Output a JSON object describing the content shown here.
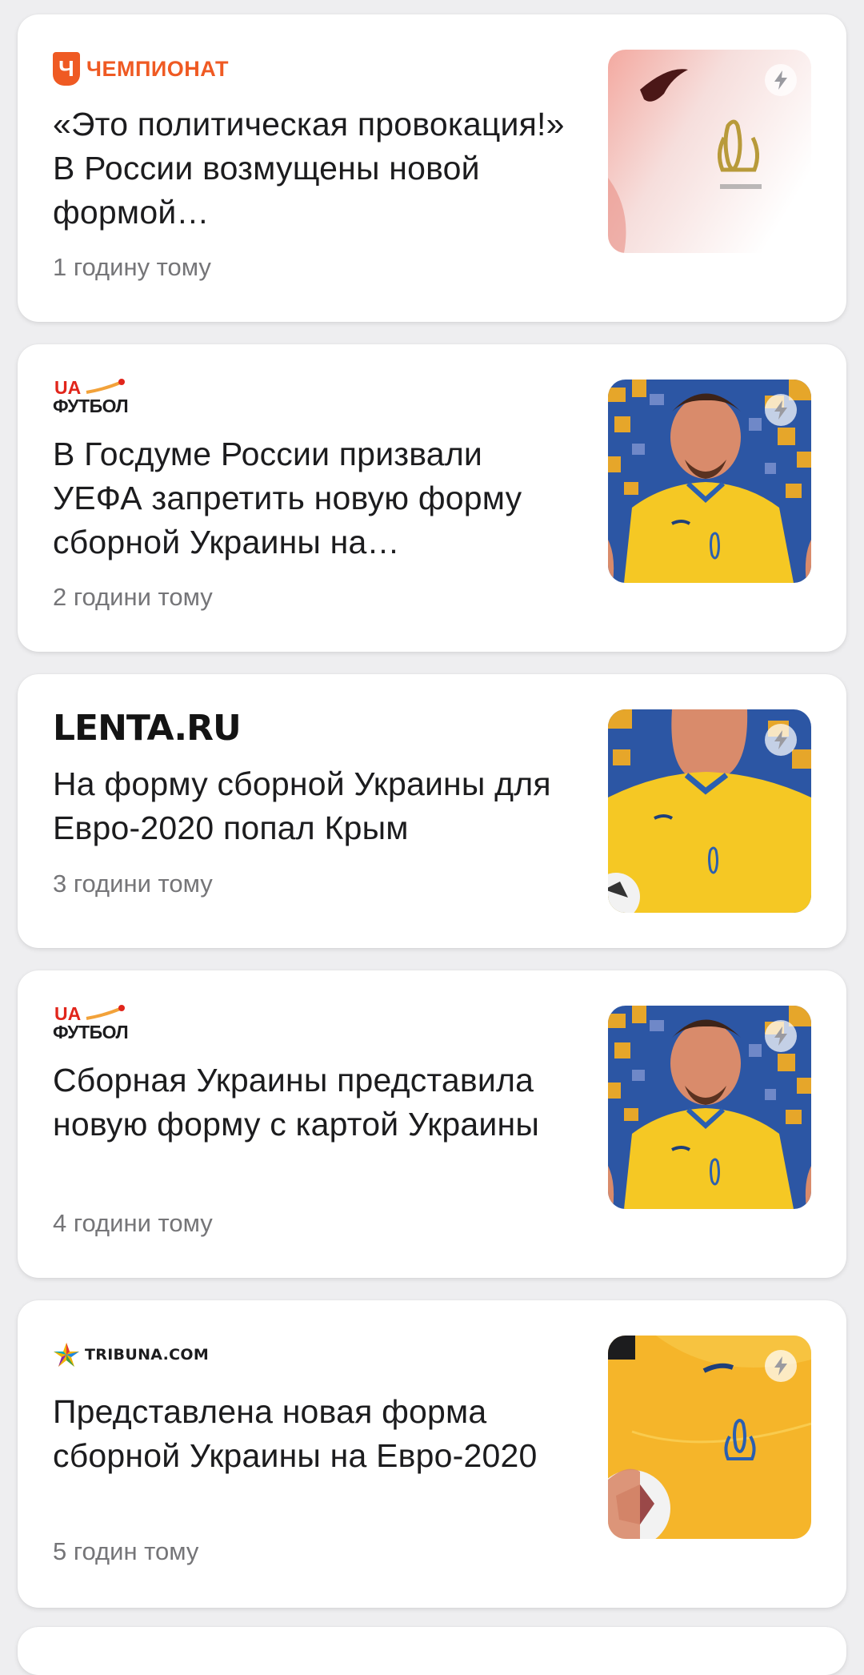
{
  "feed": {
    "items": [
      {
        "source": "ЧЕМПИОНАТ",
        "source_badge": "Ч",
        "headline": "«Это политическая провокация!» В России возмущены новой формой…",
        "time": "1 годину тому",
        "thumbnail_icon": "lightning-icon"
      },
      {
        "source_top": "UA",
        "source": "ФУТБОЛ",
        "headline": "В Госдуме России призвали УЕФА запретить новую форму сборной Украины на…",
        "time": "2 години тому",
        "thumbnail_icon": "lightning-icon"
      },
      {
        "source": "LENTA.RU",
        "headline": "На форму сборной Украины для Евро-2020 попал Крым",
        "time": "3 години тому",
        "thumbnail_icon": "lightning-icon"
      },
      {
        "source_top": "UA",
        "source": "ФУТБОЛ",
        "headline": "Сборная Украины представила новую форму с картой Украины",
        "time": "4 години тому",
        "thumbnail_icon": "lightning-icon"
      },
      {
        "source": "TRIBUNA.COM",
        "headline": "Представлена новая форма сборной Украины на Евро-2020",
        "time": "5 годин тому",
        "thumbnail_icon": "lightning-icon"
      }
    ]
  },
  "colors": {
    "background": "#eeeef0",
    "card": "#ffffff",
    "headline": "#1c1c1e",
    "time": "#757578",
    "championat_brand": "#ef5a23",
    "uafootball_red": "#e1251b",
    "kit_yellow": "#f6c22c",
    "kit_blue": "#1f57a8"
  }
}
